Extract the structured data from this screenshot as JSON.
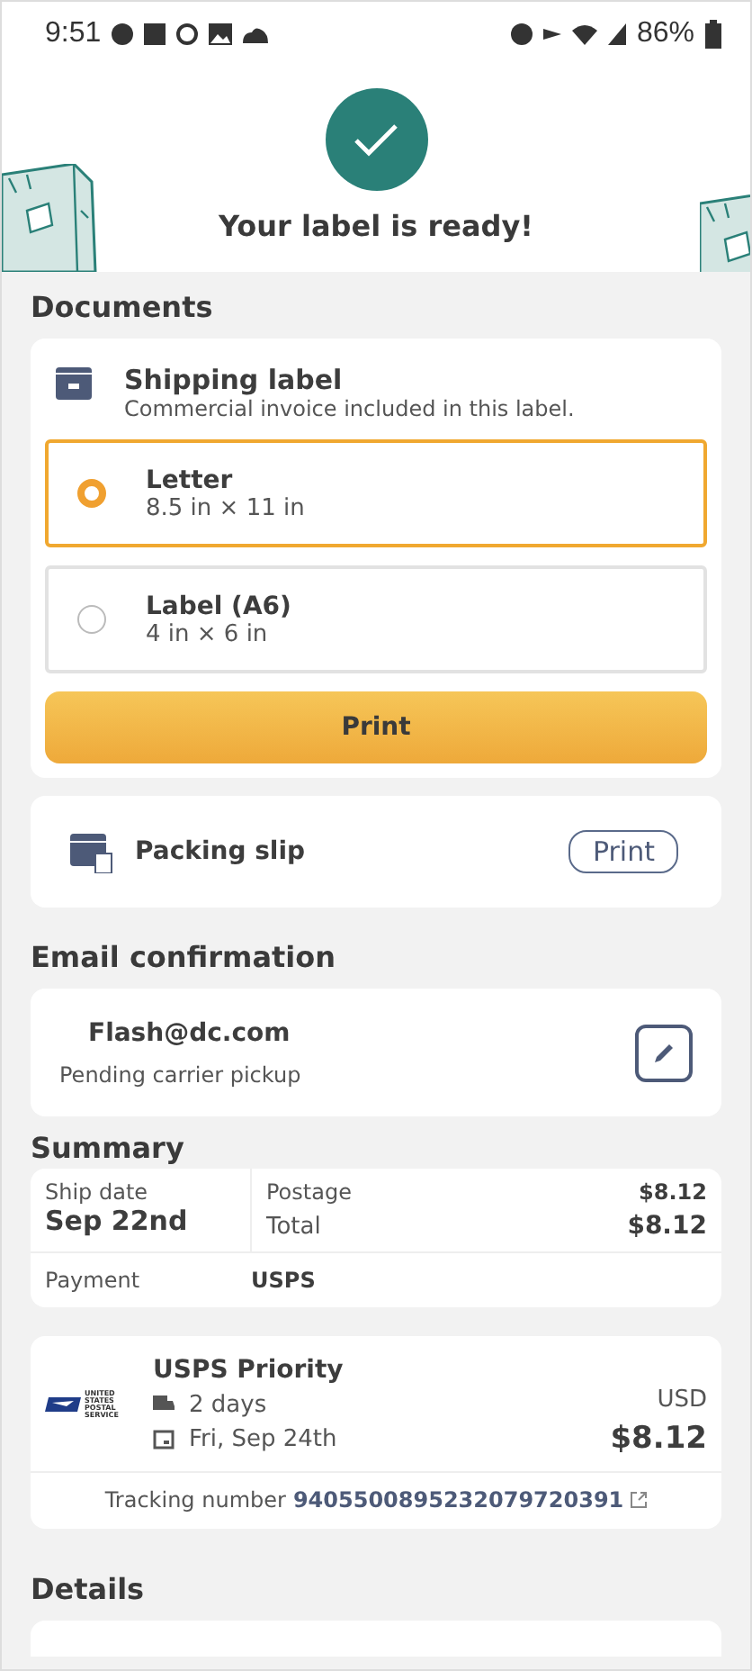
{
  "status_bar": {
    "time": "9:51",
    "battery": "86%"
  },
  "header": {
    "title": "Your label is ready!"
  },
  "documents": {
    "heading": "Documents",
    "shipping_label": {
      "title": "Shipping label",
      "subtitle": "Commercial invoice included in this label.",
      "options": [
        {
          "title": "Letter",
          "size": "8.5 in × 11 in",
          "selected": true
        },
        {
          "title": "Label (A6)",
          "size": "4 in × 6 in",
          "selected": false
        }
      ],
      "button": "Print"
    },
    "packing_slip": {
      "title": "Packing slip",
      "button": "Print"
    }
  },
  "email": {
    "heading": "Email confirmation",
    "address": "Flash@dc.com",
    "status": "Pending carrier pickup"
  },
  "summary": {
    "heading": "Summary",
    "ship_date_label": "Ship date",
    "ship_date": "Sep 22nd",
    "postage_label": "Postage",
    "postage": "$8.12",
    "total_label": "Total",
    "total": "$8.12",
    "payment_label": "Payment",
    "payment": "USPS"
  },
  "carrier": {
    "logo_text": "UNITED STATES POSTAL SERVICE",
    "service": "USPS Priority",
    "transit": "2 days",
    "delivery": "Fri, Sep 24th",
    "currency": "USD",
    "price": "$8.12",
    "tracking_label": "Tracking number",
    "tracking_number": "9405500895232079720391"
  },
  "details": {
    "heading": "Details"
  }
}
